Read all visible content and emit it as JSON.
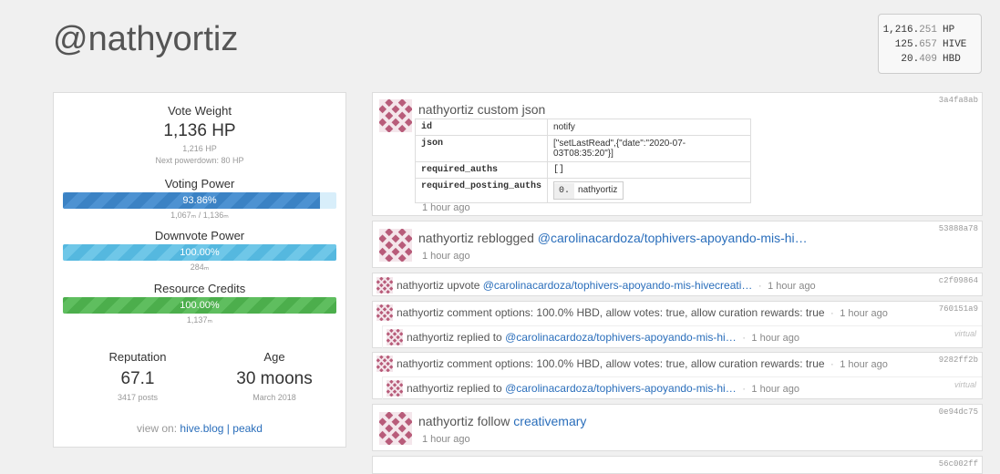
{
  "header": {
    "username": "@nathyortiz"
  },
  "balances": [
    {
      "value_main": "1,216.",
      "value_dec": "251",
      "unit": "HP"
    },
    {
      "value_main": "125.",
      "value_dec": "657",
      "unit": "HIVE"
    },
    {
      "value_main": "20.",
      "value_dec": "409",
      "unit": "HBD"
    }
  ],
  "left": {
    "vote_weight_label": "Vote Weight",
    "vote_weight_value": "1,136 HP",
    "vote_weight_sub": "1,216 HP",
    "next_powerdown": "Next powerdown: 80 HP",
    "voting_power_label": "Voting Power",
    "voting_power_value": "93.86%",
    "voting_power_fraction": 0.9386,
    "voting_power_sub": "1,067ₘ / 1,136ₘ",
    "downvote_label": "Downvote Power",
    "downvote_value": "100.00%",
    "downvote_fraction": 1.0,
    "downvote_sub": "284ₘ",
    "rc_label": "Resource Credits",
    "rc_value": "100.00%",
    "rc_fraction": 1.0,
    "rc_sub": "1,137ₘ",
    "reputation_label": "Reputation",
    "reputation_value": "67.1",
    "reputation_sub": "3417 posts",
    "age_label": "Age",
    "age_value": "30 moons",
    "age_sub": "March 2018",
    "view_on_label": "view on:",
    "view_on_link1": "hive.blog",
    "view_on_sep": "|",
    "view_on_link2": "peakd"
  },
  "feed": {
    "custom_json": {
      "user": "nathyortiz",
      "action": "custom json",
      "hash": "3a4fa8ab",
      "rows": {
        "id_key": "id",
        "id_val": "notify",
        "json_key": "json",
        "json_val": "[\"setLastRead\",{\"date\":\"2020-07-03T08:35:20\"}]",
        "ra_key": "required_auths",
        "ra_val": "[]",
        "rpa_key": "required_posting_auths",
        "rpa_idx": "0.",
        "rpa_val": "nathyortiz"
      },
      "time": "1 hour ago"
    },
    "reblog": {
      "user": "nathyortiz",
      "action": "reblogged",
      "link": "@carolinacardoza/tophivers-apoyando-mis-hi…",
      "hash": "53888a78",
      "time": "1 hour ago"
    },
    "upvote": {
      "text": "nathyortiz upvote",
      "link": "@carolinacardoza/tophivers-apoyando-mis-hivecreati…",
      "sep": "·",
      "time": "1 hour ago",
      "hash": "c2f09864"
    },
    "comment1": {
      "text": "nathyortiz comment options: 100.0% HBD, allow votes: true, allow curation rewards: true",
      "sep": "·",
      "time": "1 hour ago",
      "hash": "760151a9"
    },
    "reply1": {
      "text": "nathyortiz replied to",
      "link": "@carolinacardoza/tophivers-apoyando-mis-hi…",
      "sep": "·",
      "time": "1 hour ago",
      "virtual": "virtual"
    },
    "comment2": {
      "text": "nathyortiz comment options: 100.0% HBD, allow votes: true, allow curation rewards: true",
      "sep": "·",
      "time": "1 hour ago",
      "hash": "9282ff2b"
    },
    "reply2": {
      "text": "nathyortiz replied to",
      "link": "@carolinacardoza/tophivers-apoyando-mis-hi…",
      "sep": "·",
      "time": "1 hour ago",
      "virtual": "virtual"
    },
    "follow": {
      "user": "nathyortiz",
      "action": "follow",
      "link": "creativemary",
      "hash": "0e94dc75",
      "time": "1 hour ago"
    },
    "partial_hash": "56c002ff"
  },
  "colors": {
    "identicon": "#b85c7a",
    "link": "#2a6ebb"
  }
}
